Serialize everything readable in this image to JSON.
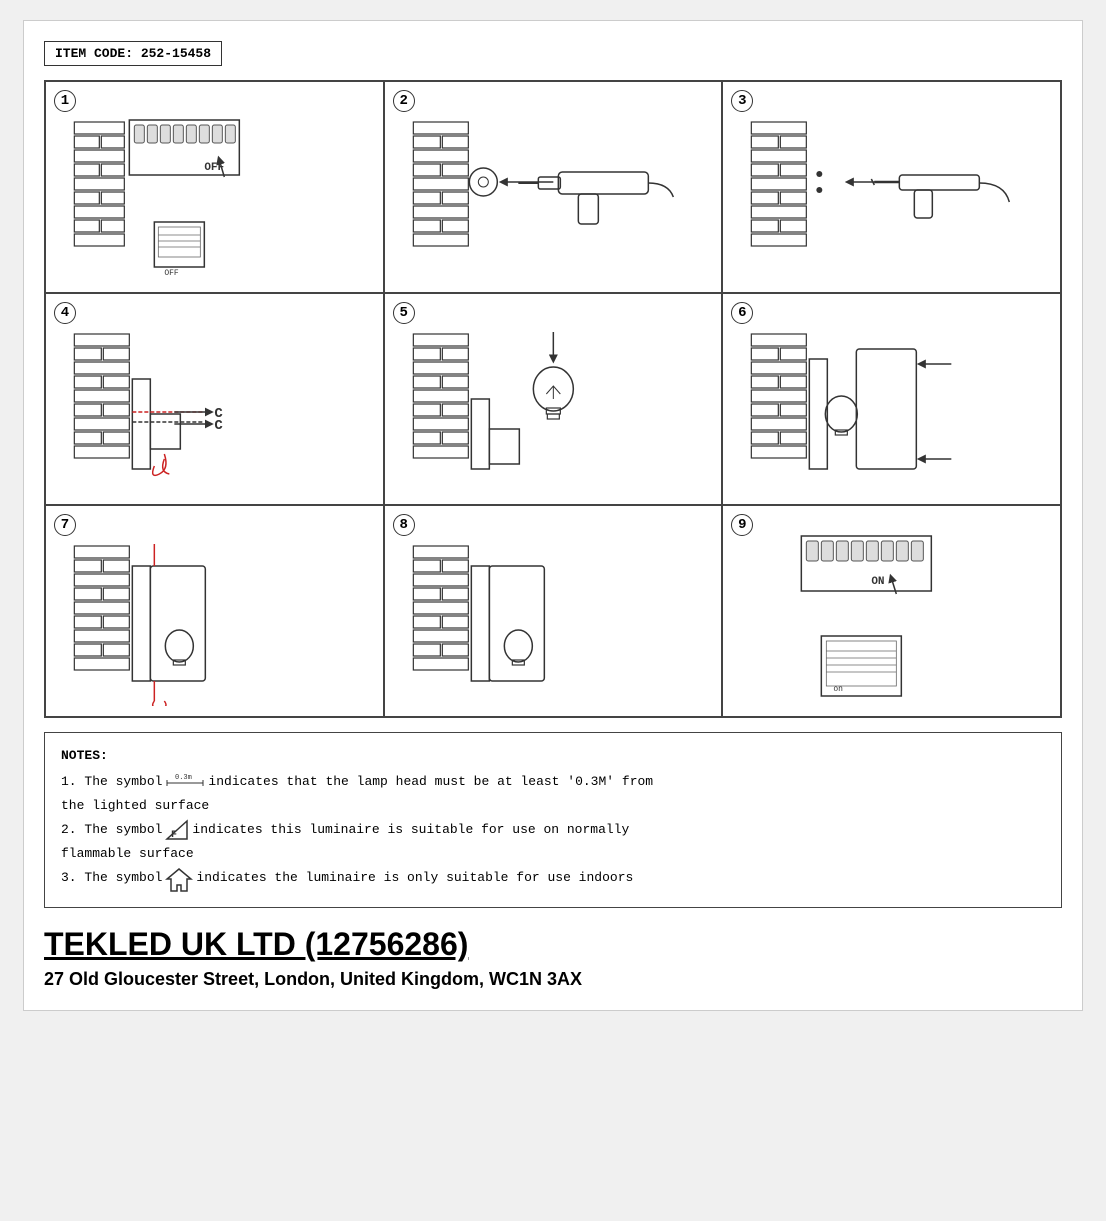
{
  "item_code": "ITEM CODE: 252-15458",
  "company": {
    "name": "TEKLED UK LTD (12756286)",
    "address": "27 Old Gloucester Street, London, United Kingdom, WC1N 3AX"
  },
  "notes": {
    "title": "NOTES:",
    "lines": [
      "1. The symbol [dist] indicates that the lamp head must be at least '0.3M' from the lighted surface",
      "2. The symbol [F] indicates this luminaire is suitable for use on normally flammable surface",
      "3. The symbol [house] indicates the luminaire is only suitable for use indoors"
    ]
  },
  "steps": [
    {
      "number": "1"
    },
    {
      "number": "2"
    },
    {
      "number": "3"
    },
    {
      "number": "4"
    },
    {
      "number": "5"
    },
    {
      "number": "6"
    },
    {
      "number": "7"
    },
    {
      "number": "8"
    },
    {
      "number": "9"
    }
  ]
}
